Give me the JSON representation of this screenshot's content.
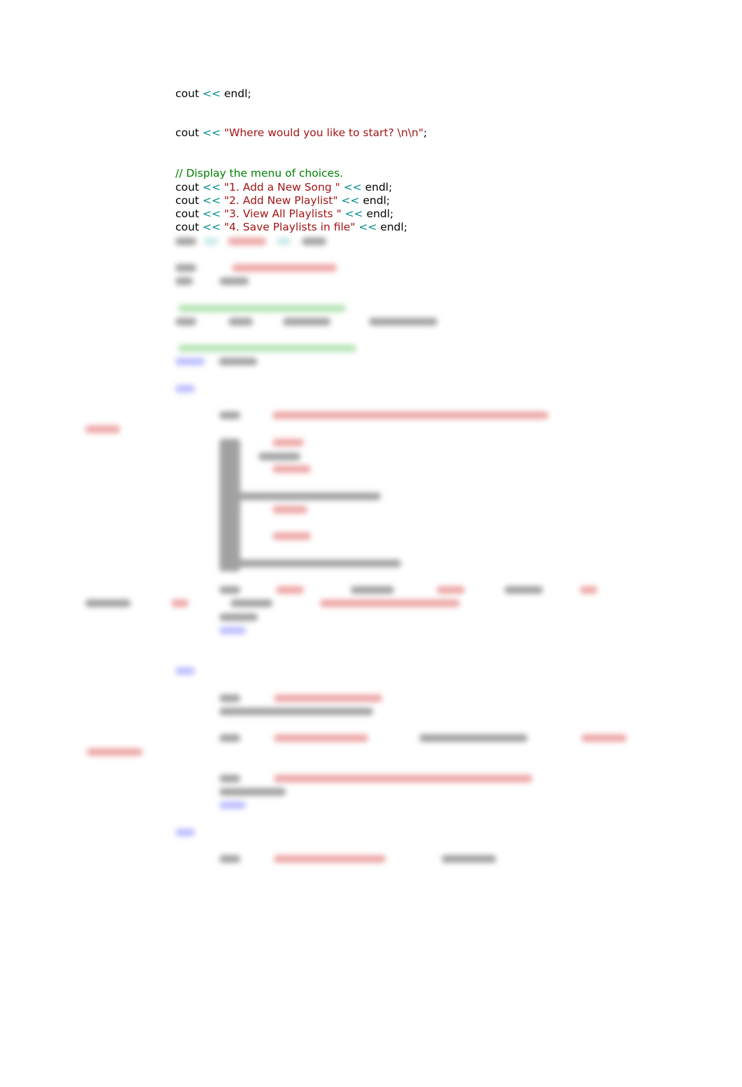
{
  "code": {
    "line1": {
      "ident": "cout",
      "op": "<<",
      "rest": " endl;"
    },
    "line2": {
      "ident": "cout",
      "op": "<<",
      "str": "\"Where would you like to start? \\n\\n\"",
      "rest": ";"
    },
    "comment": "// Display the menu of choices.",
    "menu": [
      {
        "ident": "cout",
        "op1": "<<",
        "str": "\"1. Add a New Song \"",
        "op2": "<<",
        "rest": " endl;"
      },
      {
        "ident": "cout",
        "op1": "<<",
        "str": "\"2. Add New Playlist\"",
        "op2": "<<",
        "rest": " endl;"
      },
      {
        "ident": "cout",
        "op1": "<<",
        "str": "\"3. View All Playlists \"",
        "op2": "<<",
        "rest": " endl;"
      },
      {
        "ident": "cout",
        "op1": "<<",
        "str": "\"4. Save Playlists in file\"",
        "op2": "<<",
        "rest": " endl;"
      }
    ]
  },
  "colors": {
    "operator": "#008b8b",
    "string": "#a31515",
    "comment": "#008000",
    "keyword": "#0000ff"
  },
  "obscured_notice": "remaining code is blurred / unreadable"
}
